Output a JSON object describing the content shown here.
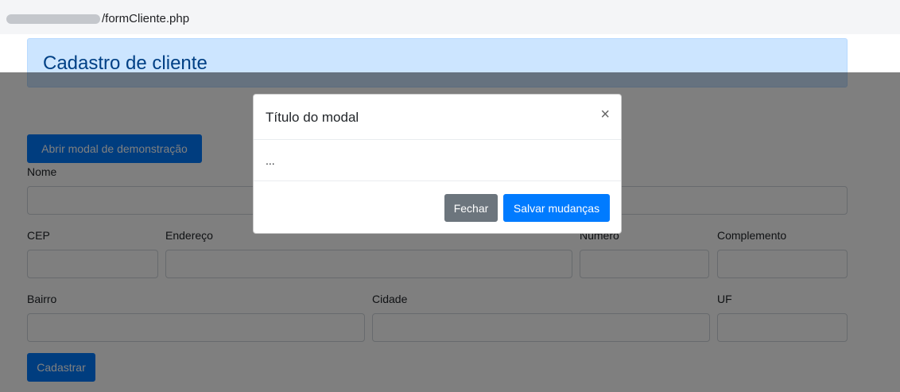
{
  "browser": {
    "url_suffix": "/formCliente.php"
  },
  "page": {
    "title": "Cadastro de cliente",
    "open_modal_button": "Abrir modal de demonstração",
    "labels": {
      "nome": "Nome",
      "cep": "CEP",
      "endereco": "Endereço",
      "numero": "Número",
      "complemento": "Complemento",
      "bairro": "Bairro",
      "cidade": "Cidade",
      "uf": "UF"
    },
    "submit_button": "Cadastrar"
  },
  "modal": {
    "title": "Título do modal",
    "close_symbol": "×",
    "body": "...",
    "close_button": "Fechar",
    "save_button": "Salvar mudanças"
  },
  "colors": {
    "primary": "#007bff",
    "secondary": "#6c757d",
    "jumbotron_bg": "#cce5ff",
    "jumbotron_text": "#004085"
  }
}
